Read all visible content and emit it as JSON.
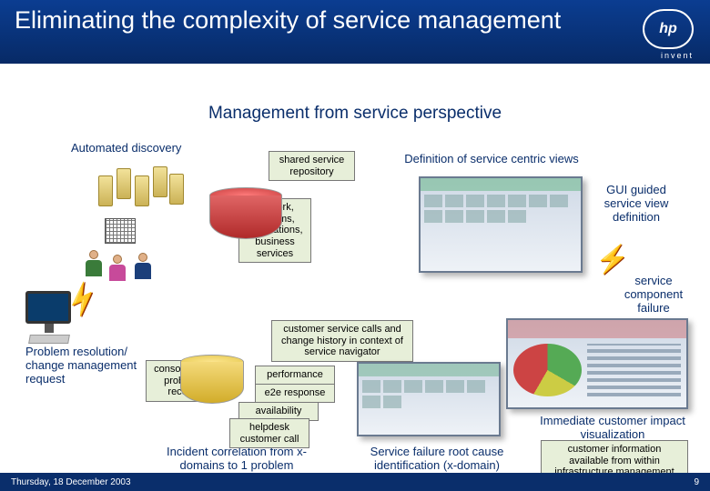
{
  "header": {
    "title": "Eliminating the complexity of service management",
    "logo": "hp",
    "tagline": "invent"
  },
  "subtitle": "Management from service perspective",
  "labels": {
    "automated_discovery": "Automated discovery",
    "definition_views": "Definition of service centric views",
    "gui_guided": "GUI guided service view definition",
    "service_failure": "service component failure",
    "problem_resolution": "Problem resolution/ change management request",
    "immediate_impact": "Immediate customer impact visualization",
    "incident_correlation": "Incident correlation from x-domains to 1 problem",
    "root_cause": "Service failure root cause identification (x-domain)"
  },
  "boxes": {
    "shared_repo": "shared service repository",
    "network": "network, systems, applications, business services",
    "consolidated": "consolidated problem record",
    "calls": "customer service calls and change history in context of service navigator",
    "performance": "performance",
    "e2e": "e2e response",
    "availability": "availability",
    "helpdesk": "helpdesk customer call",
    "customer_info": "customer information available from within infrastructure management"
  },
  "footer": {
    "date": "Thursday, 18 December 2003",
    "page": "9"
  }
}
